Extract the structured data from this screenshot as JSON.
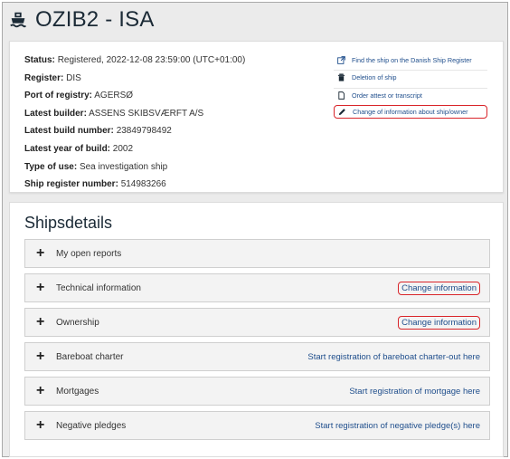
{
  "header": {
    "title": "OZIB2 - ISA",
    "icon": "ship-icon"
  },
  "info": [
    {
      "key": "Status:",
      "value": "Registered, 2022-12-08 23:59:00 (UTC+01:00)"
    },
    {
      "key": "Register:",
      "value": "DIS"
    },
    {
      "key": "Port of registry:",
      "value": "AGERSØ"
    },
    {
      "key": "Latest builder:",
      "value": "ASSENS SKIBSVÆRFT A/S"
    },
    {
      "key": "Latest build number:",
      "value": "23849798492"
    },
    {
      "key": "Latest year of build:",
      "value": "2002"
    },
    {
      "key": "Type of use:",
      "value": "Sea investigation ship"
    },
    {
      "key": "Ship register number:",
      "value": "514983266"
    }
  ],
  "actions": [
    {
      "label": "Find the ship on the Danish Ship Register",
      "icon": "external-link-icon"
    },
    {
      "label": "Deletion of ship",
      "icon": "trash-icon"
    },
    {
      "label": "Order attest or transcript",
      "icon": "document-icon"
    },
    {
      "label": "Change of information about ship/owner",
      "icon": "pencil-icon"
    }
  ],
  "details": {
    "title": "Shipsdetails",
    "rows": [
      {
        "label": "My open reports",
        "link": ""
      },
      {
        "label": "Technical information",
        "link": "Change information"
      },
      {
        "label": "Ownership",
        "link": "Change information"
      },
      {
        "label": "Bareboat charter",
        "link": "Start registration of bareboat charter-out here"
      },
      {
        "label": "Mortgages",
        "link": "Start registration of mortgage here"
      },
      {
        "label": "Negative pledges",
        "link": "Start registration of negative pledge(s) here"
      }
    ]
  },
  "colors": {
    "link": "#1f4e8c",
    "highlight": "#d9252a",
    "background": "#ebebeb"
  }
}
